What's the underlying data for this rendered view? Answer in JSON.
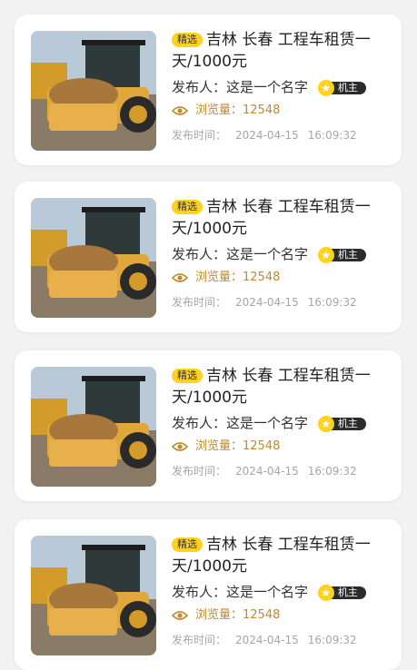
{
  "listings": [
    {
      "tag": "精选",
      "title": "吉林 长春 工程车租赁一天/1000元",
      "publisher_label": "发布人：",
      "publisher_name": "这是一个名字",
      "role": "机主",
      "views_label": "浏览量：",
      "views": "12548",
      "time_label": "发布时间：",
      "date": "2024-04-15",
      "time": "16:09:32"
    },
    {
      "tag": "精选",
      "title": "吉林 长春 工程车租赁一天/1000元",
      "publisher_label": "发布人：",
      "publisher_name": "这是一个名字",
      "role": "机主",
      "views_label": "浏览量：",
      "views": "12548",
      "time_label": "发布时间：",
      "date": "2024-04-15",
      "time": "16:09:32"
    },
    {
      "tag": "精选",
      "title": "吉林 长春 工程车租赁一天/1000元",
      "publisher_label": "发布人：",
      "publisher_name": "这是一个名字",
      "role": "机主",
      "views_label": "浏览量：",
      "views": "12548",
      "time_label": "发布时间：",
      "date": "2024-04-15",
      "time": "16:09:32"
    },
    {
      "tag": "精选",
      "title": "吉林 长春 工程车租赁一天/1000元",
      "publisher_label": "发布人：",
      "publisher_name": "这是一个名字",
      "role": "机主",
      "views_label": "浏览量：",
      "views": "12548",
      "time_label": "发布时间：",
      "date": "2024-04-15",
      "time": "16:09:32"
    }
  ],
  "icons": {
    "views": "eye-icon",
    "role": "star-icon",
    "thumbnail": "road-roller-image"
  },
  "colors": {
    "tag": "#ffd21f",
    "views": "#c08a2d",
    "role_badge": "#2b2b2b"
  }
}
